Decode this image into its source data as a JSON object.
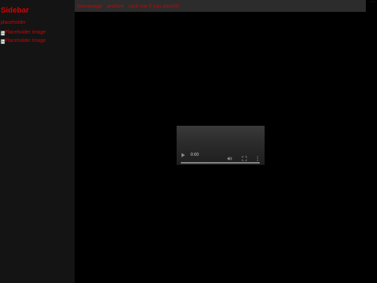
{
  "sidebar": {
    "title": "Sidebar",
    "text": "placeholder",
    "images": [
      {
        "alt": "Placeholder Image"
      },
      {
        "alt": "Placeholder Image"
      }
    ]
  },
  "nav": {
    "links": [
      {
        "label": "homepage"
      },
      {
        "label": "archive"
      },
      {
        "label": "click me if you dare!!!!"
      }
    ]
  },
  "video": {
    "time": "0:00",
    "progress": 0
  },
  "colors": {
    "page_bg": "#000000",
    "sidebar_bg": "#141414",
    "nav_bg": "#2c2c2c",
    "accent_red": "#d40000"
  },
  "icons": {
    "play": "play-icon",
    "volume": "volume-icon",
    "fullscreen": "fullscreen-icon",
    "more": "more-vertical-icon",
    "broken_image": "broken-image-icon"
  }
}
